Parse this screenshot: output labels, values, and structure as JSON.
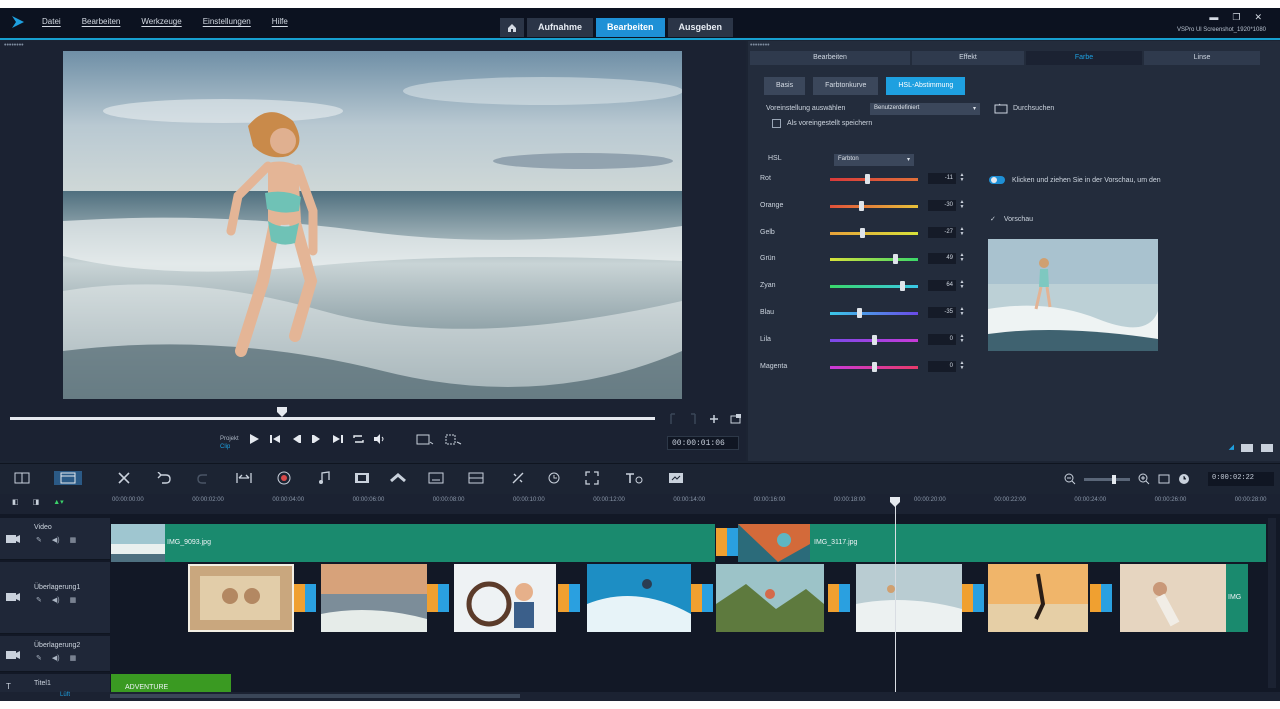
{
  "app": {
    "menu": [
      "Datei",
      "Bearbeiten",
      "Werkzeuge",
      "Einstellungen",
      "Hilfe"
    ],
    "mode_tabs": [
      {
        "label": "Aufnahme",
        "active": false
      },
      {
        "label": "Bearbeiten",
        "active": true
      },
      {
        "label": "Ausgeben",
        "active": false
      }
    ],
    "window_info": "VSPro Ul Screenshot_1920*1080",
    "accent_color": "#1e90d6"
  },
  "player": {
    "project_label": "Projekt",
    "clip_label": "Clip",
    "timecode": "00:00:01:06"
  },
  "panel": {
    "tabs": [
      {
        "label": "Bearbeiten",
        "active": false
      },
      {
        "label": "Effekt",
        "active": false
      },
      {
        "label": "Farbe",
        "active": true
      },
      {
        "label": "Linse",
        "active": false
      }
    ],
    "subtabs": [
      {
        "label": "Basis",
        "active": false
      },
      {
        "label": "Farbtonkurve",
        "active": false
      },
      {
        "label": "HSL-Abstimmung",
        "active": true
      }
    ],
    "preset_label": "Voreinstellung auswählen",
    "preset_value": "Benutzerdefiniert",
    "browse_label": "Durchsuchen",
    "save_preset_label": "Als voreingestellt speichern",
    "hsl_label": "HSL",
    "hsl_value": "Farbton",
    "hint": "Klicken und ziehen Sie in der Vorschau, um den",
    "thumb_checkbox": "Vorschau",
    "sliders": [
      {
        "label": "Rot",
        "value": "-11",
        "pos": 0.42,
        "gradient": "linear-gradient(90deg,#d93a3a,#e0703a)"
      },
      {
        "label": "Orange",
        "value": "-30",
        "pos": 0.35,
        "gradient": "linear-gradient(90deg,#e0503a,#e8c23a)"
      },
      {
        "label": "Gelb",
        "value": "-27",
        "pos": 0.36,
        "gradient": "linear-gradient(90deg,#e8a23a,#d8e23a)"
      },
      {
        "label": "Grün",
        "value": "49",
        "pos": 0.74,
        "gradient": "linear-gradient(90deg,#d8e23a,#3ad86a)"
      },
      {
        "label": "Zyan",
        "value": "64",
        "pos": 0.82,
        "gradient": "linear-gradient(90deg,#3ad86a,#3ac8e8)"
      },
      {
        "label": "Blau",
        "value": "-35",
        "pos": 0.33,
        "gradient": "linear-gradient(90deg,#3ac8e8,#6a4ae8)"
      },
      {
        "label": "Lila",
        "value": "0",
        "pos": 0.5,
        "gradient": "linear-gradient(90deg,#7a4ae8,#c83ad8)"
      },
      {
        "label": "Magenta",
        "value": "0",
        "pos": 0.5,
        "gradient": "linear-gradient(90deg,#c83ad8,#e83a6a)"
      }
    ]
  },
  "timeline": {
    "zoom_timecode": "0:00:02:22",
    "ruler_ticks": [
      "00:00:00:00",
      "00:00:02:00",
      "00:00:04:00",
      "00:00:06:00",
      "00:00:08:00",
      "00:00:10:00",
      "00:00:12:00",
      "00:00:14:00",
      "00:00:16:00",
      "00:00:18:00",
      "00:00:20:00",
      "00:00:22:00",
      "00:00:24:00",
      "00:00:26:00",
      "00:00:28:00"
    ],
    "tracks": [
      {
        "name": "Video"
      },
      {
        "name": "Überlagerung1"
      },
      {
        "name": "Überlagerung2"
      },
      {
        "name": "Titel1"
      }
    ],
    "video_clips": [
      "IMG_9093.jpg",
      "IMG_3117.jpg"
    ],
    "overlay_tail": "IMG",
    "title_clip": "ADVENTURE",
    "footer_label": "Lüft"
  }
}
